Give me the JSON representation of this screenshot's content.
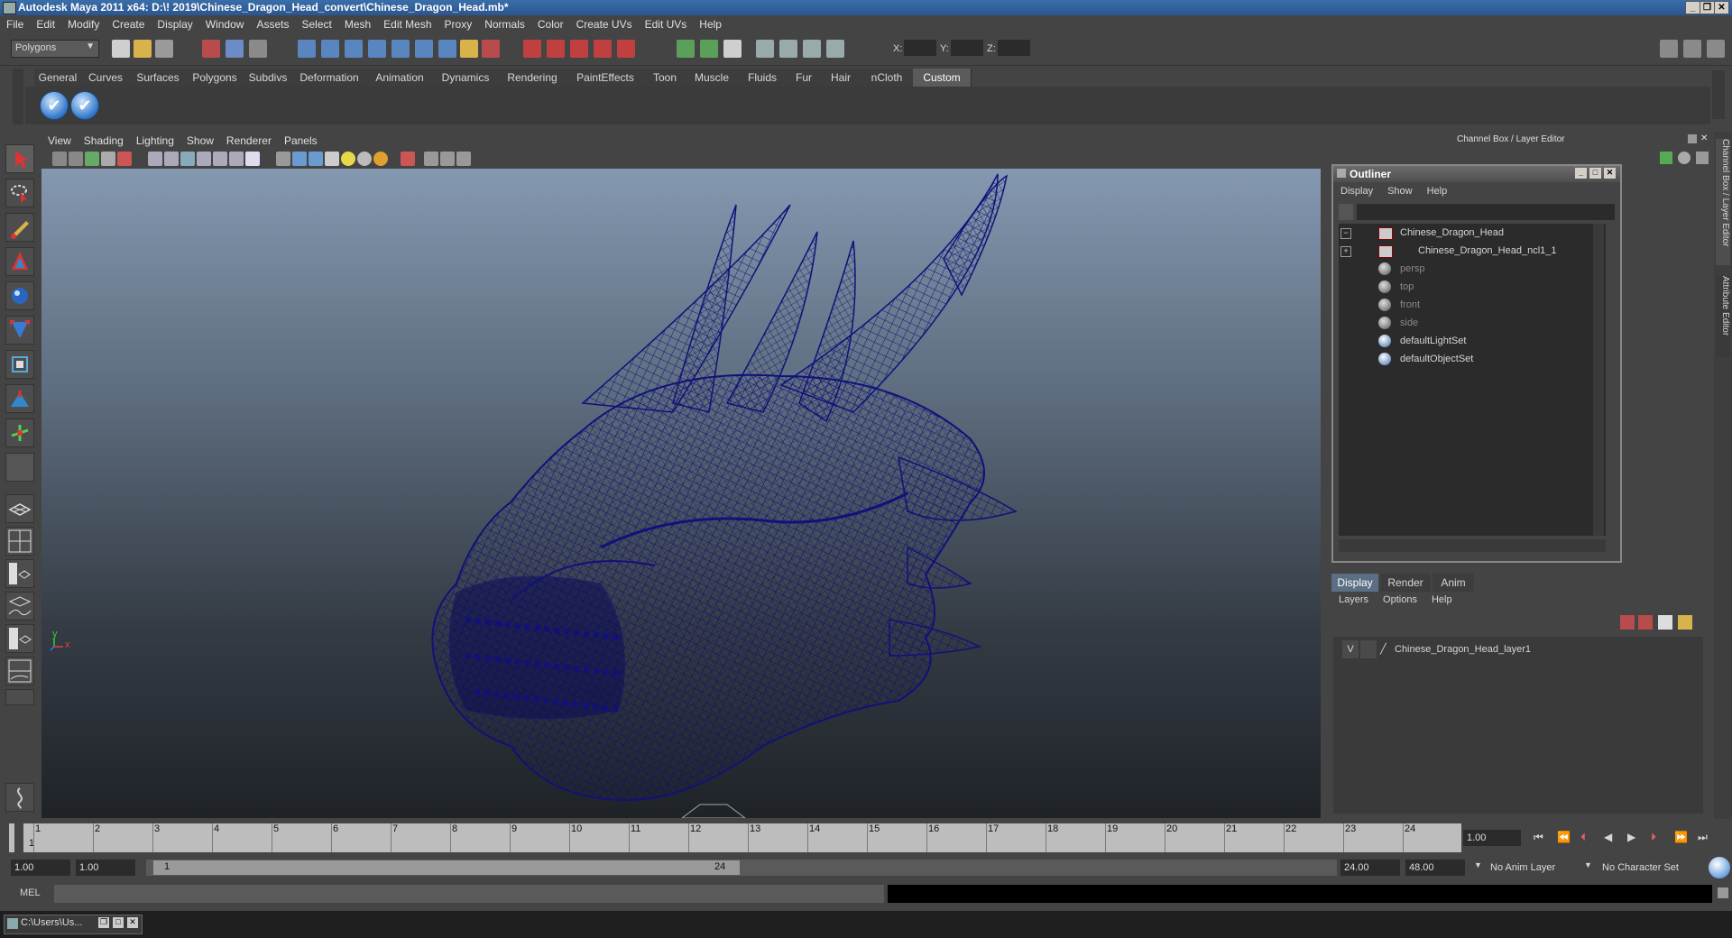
{
  "window": {
    "title": "Autodesk Maya 2011 x64: D:\\! 2019\\Chinese_Dragon_Head_convert\\Chinese_Dragon_Head.mb*"
  },
  "menubar": [
    "File",
    "Edit",
    "Modify",
    "Create",
    "Display",
    "Window",
    "Assets",
    "Select",
    "Mesh",
    "Edit Mesh",
    "Proxy",
    "Normals",
    "Color",
    "Create UVs",
    "Edit UVs",
    "Help"
  ],
  "statusline": {
    "mode": "Polygons",
    "x_label": "X:",
    "y_label": "Y:",
    "z_label": "Z:"
  },
  "shelf": {
    "tabs": [
      "General",
      "Curves",
      "Surfaces",
      "Polygons",
      "Subdivs",
      "Deformation",
      "Animation",
      "Dynamics",
      "Rendering",
      "PaintEffects",
      "Toon",
      "Muscle",
      "Fluids",
      "Fur",
      "Hair",
      "nCloth",
      "Custom"
    ],
    "active_tab": "Custom"
  },
  "viewport": {
    "menu": [
      "View",
      "Shading",
      "Lighting",
      "Show",
      "Renderer",
      "Panels"
    ],
    "axis_x": "x",
    "axis_y": "y",
    "wire_color": "#10107a"
  },
  "right_panel": {
    "header": "Channel Box / Layer Editor",
    "side_tab_1": "Channel Box / Layer Editor",
    "side_tab_2": "Attribute Editor"
  },
  "outliner": {
    "title": "Outliner",
    "menu": [
      "Display",
      "Show",
      "Help"
    ],
    "items": [
      {
        "label": "Chinese_Dragon_Head",
        "icon": "mesh-icon",
        "expander": "−"
      },
      {
        "label": "Chinese_Dragon_Head_ncl1_1",
        "icon": "mesh-icon",
        "expander": "+"
      },
      {
        "label": "persp",
        "icon": "camera-icon",
        "dim": true
      },
      {
        "label": "top",
        "icon": "camera-icon",
        "dim": true
      },
      {
        "label": "front",
        "icon": "camera-icon",
        "dim": true
      },
      {
        "label": "side",
        "icon": "camera-icon",
        "dim": true
      },
      {
        "label": "defaultLightSet",
        "icon": "set-icon"
      },
      {
        "label": "defaultObjectSet",
        "icon": "set-icon"
      }
    ]
  },
  "layer_editor": {
    "tabs": [
      "Display",
      "Render",
      "Anim"
    ],
    "menu": [
      "Layers",
      "Options",
      "Help"
    ],
    "layers": [
      {
        "visible": "V",
        "name": "Chinese_Dragon_Head_layer1"
      }
    ]
  },
  "timeline": {
    "ticks": [
      "1",
      "2",
      "3",
      "4",
      "5",
      "6",
      "7",
      "8",
      "9",
      "10",
      "11",
      "12",
      "13",
      "14",
      "15",
      "16",
      "17",
      "18",
      "19",
      "20",
      "21",
      "22",
      "23",
      "24"
    ],
    "current_frame_marker": "1",
    "current_time": "1.00"
  },
  "range": {
    "start_time": "1.00",
    "playback_start": "1.00",
    "slider_start": "1",
    "slider_end": "24",
    "playback_end": "24.00",
    "end_time": "48.00",
    "anim_layer": "No Anim Layer",
    "character_set": "No Character Set"
  },
  "commandline": {
    "label": "MEL"
  },
  "taskbar": {
    "item": "C:\\Users\\Us..."
  }
}
